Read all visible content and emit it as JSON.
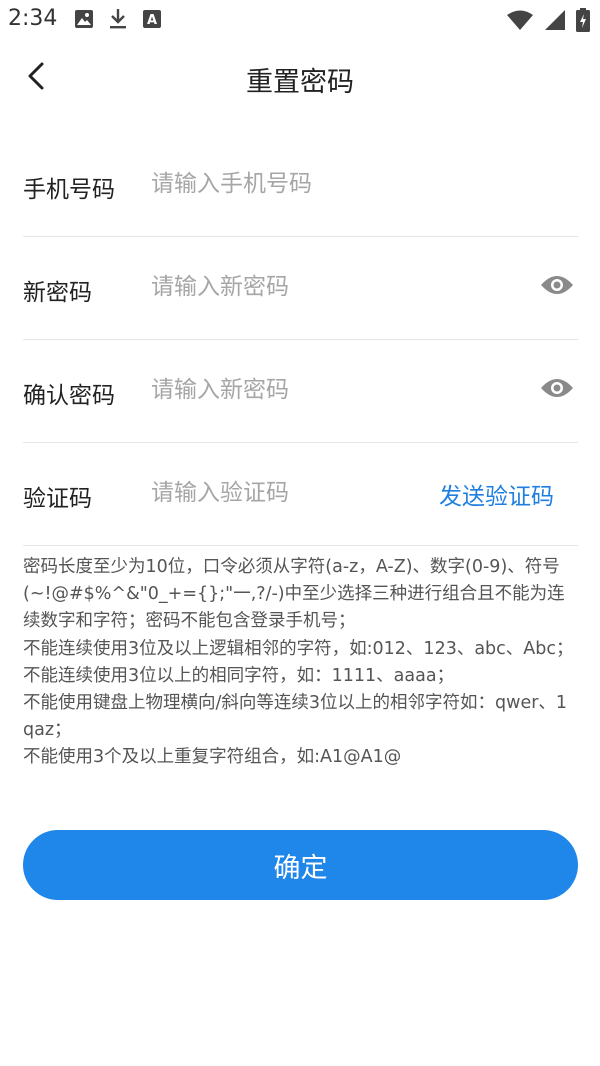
{
  "status_bar": {
    "time": "2:34",
    "icons": [
      "image-icon",
      "download-icon",
      "font-a-icon",
      "wifi-icon",
      "signal-icon",
      "battery-icon"
    ]
  },
  "header": {
    "title": "重置密码",
    "back_icon": "chevron-left-icon"
  },
  "form": {
    "phone": {
      "label": "手机号码",
      "placeholder": "请输入手机号码",
      "value": ""
    },
    "new_password": {
      "label": "新密码",
      "placeholder": "请输入新密码",
      "value": "",
      "toggle_icon": "eye-icon"
    },
    "confirm_password": {
      "label": "确认密码",
      "placeholder": "请输入新密码",
      "value": "",
      "toggle_icon": "eye-icon"
    },
    "code": {
      "label": "验证码",
      "placeholder": "请输入验证码",
      "value": "",
      "send_label": "发送验证码"
    }
  },
  "rules": [
    "密码长度至少为10位，口令必须从字符(a-z，A-Z)、数字(0-9)、符号(~!@#$%^&\"0_+={};\"一,?/-)中至少选择三种进行组合且不能为连续数字和字符；密码不能包含登录手机号；",
    "不能连续使用3位及以上逻辑相邻的字符，如:012、123、abc、Abc；",
    "不能连续使用3位以上的相同字符，如：1111、aaaa；",
    "不能使用键盘上物理横向/斜向等连续3位以上的相邻字符如：qwer、1qaz；",
    "不能使用3个及以上重复字符组合，如:A1@A1@"
  ],
  "confirm_label": "确定",
  "colors": {
    "accent": "#1f86ea",
    "link": "#1f7fe0",
    "placeholder": "#a6a6a6",
    "divider": "#e6e6e6"
  }
}
